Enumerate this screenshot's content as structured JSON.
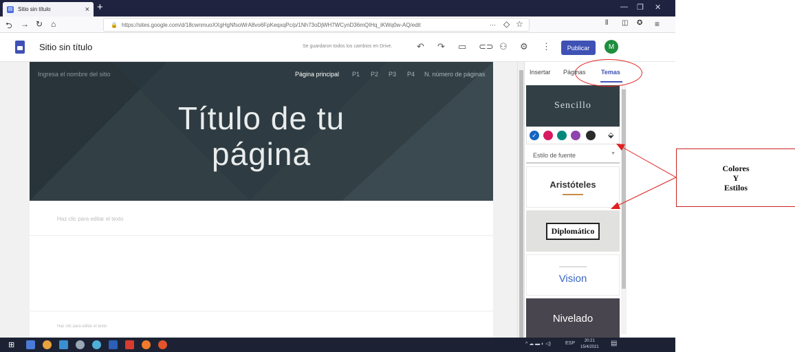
{
  "browser": {
    "tab_title": "Sitio sin título",
    "tab_close": "×",
    "new_tab": "+",
    "url": "https://sites.google.com/d/18cwnmuoXXgHgNfsoWrA8vo6FpKeqxqPc/p/1Nh73oDjWH7WCynD36mQIHq_iKWq0w-AQ/edit",
    "url_dots": "···"
  },
  "sites_bar": {
    "site_title": "Sitio sin título",
    "save_status": "Se guardaron todos los cambios en Drive.",
    "publish_label": "Publicar",
    "avatar_letter": "M"
  },
  "hero": {
    "site_name_placeholder": "Ingresa el nombre del sitio",
    "nav": [
      "Página principal",
      "P1",
      "P2",
      "P3",
      "P4",
      "N. número de páginas"
    ],
    "title_line1": "Título de tu",
    "title_line2": "página"
  },
  "body": {
    "edit_placeholder_1": "Haz clic para editar el texto",
    "edit_placeholder_2": "Haz clic para editar el texto"
  },
  "panel": {
    "tabs": [
      "Insertar",
      "Páginas",
      "Temas"
    ],
    "active_tab": "Temas",
    "themes": {
      "sencillo": "Sencillo",
      "aristoteles": "Aristóteles",
      "diplomatico": "Diplomático",
      "vision": "Vision",
      "nivelado": "Nivelado"
    },
    "font_style_label": "Estilo de fuente",
    "swatch_colors": [
      "#1565c0",
      "#d81b60",
      "#00897b",
      "#8e44ad",
      "#2b2b2b"
    ]
  },
  "annotation": {
    "line1": "Colores",
    "line2": "Y",
    "line3": "Estilos",
    "color": "#e02020"
  },
  "taskbar": {
    "lang": "ESP",
    "time": "20:21",
    "date": "15/4/2021"
  }
}
